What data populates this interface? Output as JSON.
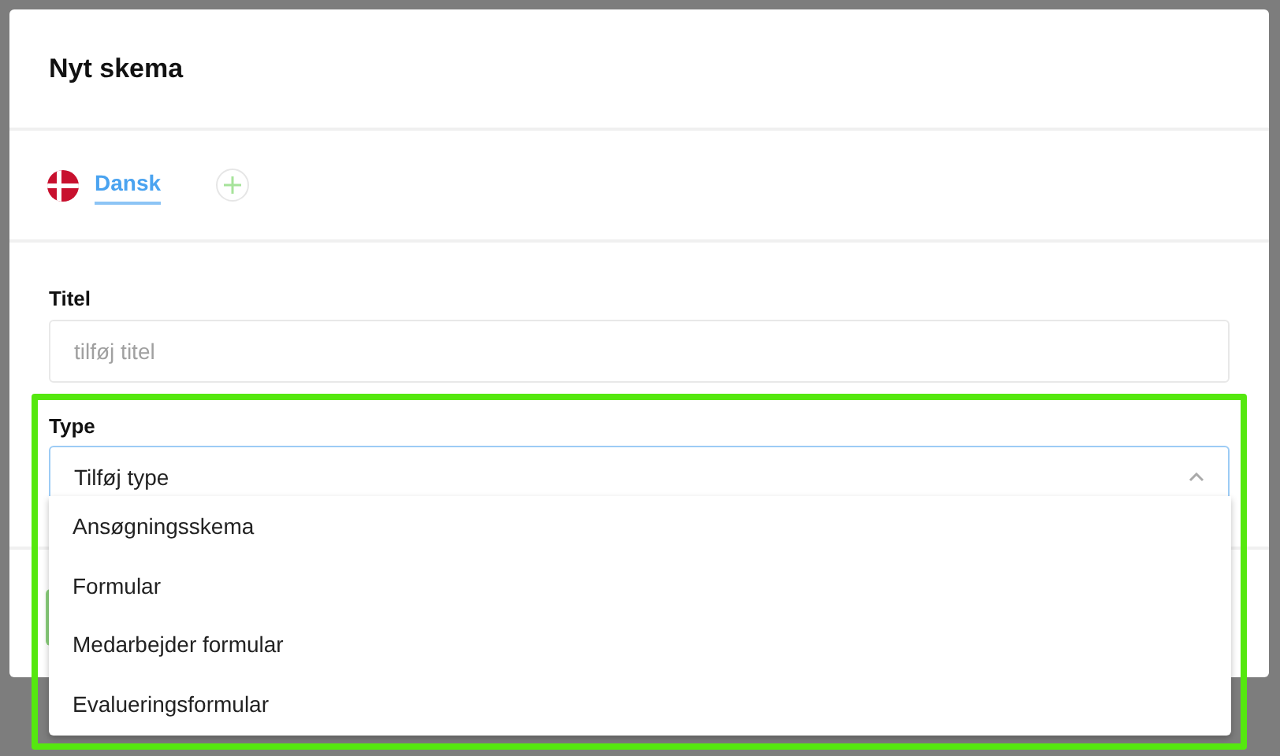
{
  "dialog": {
    "title": "Nyt skema"
  },
  "languages": [
    {
      "label": "Dansk",
      "selected": true
    }
  ],
  "title_field": {
    "label": "Titel",
    "placeholder": "tilføj titel"
  },
  "type_field": {
    "label": "Type",
    "placeholder": "Tilføj type",
    "expanded": true,
    "options": [
      "Ansøgningsskema",
      "Formular",
      "Medarbejder formular",
      "Evalueringsformular"
    ]
  }
}
